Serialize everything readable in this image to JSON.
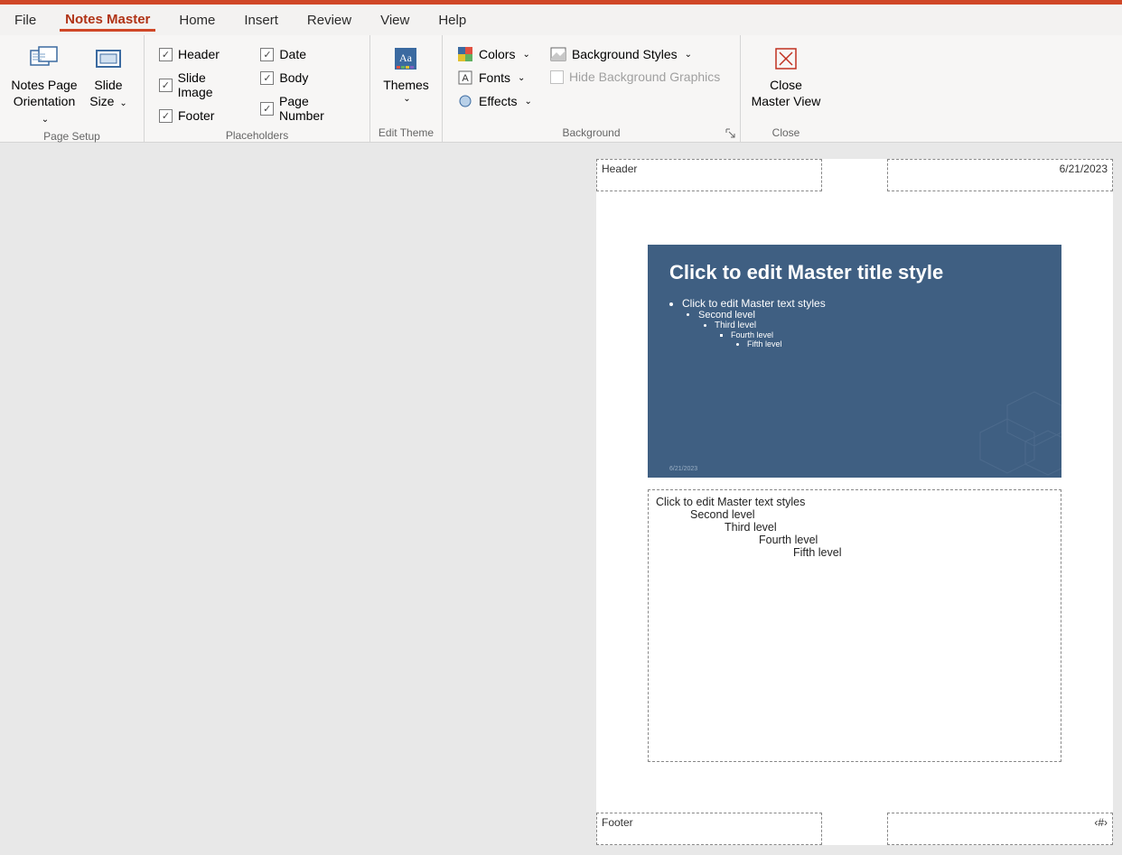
{
  "menu": {
    "items": [
      "File",
      "Notes Master",
      "Home",
      "Insert",
      "Review",
      "View",
      "Help"
    ],
    "active_index": 1
  },
  "ribbon": {
    "page_setup": {
      "label": "Page Setup",
      "notes_orientation": "Notes Page\nOrientation",
      "slide_size": "Slide\nSize"
    },
    "placeholders": {
      "label": "Placeholders",
      "items": [
        {
          "label": "Header",
          "checked": true
        },
        {
          "label": "Slide Image",
          "checked": true
        },
        {
          "label": "Footer",
          "checked": true
        },
        {
          "label": "Date",
          "checked": true
        },
        {
          "label": "Body",
          "checked": true
        },
        {
          "label": "Page Number",
          "checked": true
        }
      ]
    },
    "edit_theme": {
      "label": "Edit Theme",
      "themes": "Themes"
    },
    "background": {
      "label": "Background",
      "colors": "Colors",
      "fonts": "Fonts",
      "effects": "Effects",
      "bg_styles": "Background Styles",
      "hide_bg": "Hide Background Graphics"
    },
    "close": {
      "label": "Close",
      "close_master": "Close\nMaster View"
    }
  },
  "page": {
    "header": "Header",
    "date": "6/21/2023",
    "footer": "Footer",
    "pagenum": "‹#›",
    "slide": {
      "title": "Click to edit Master title style",
      "levels": [
        "Click to edit Master text styles",
        "Second level",
        "Third level",
        "Fourth level",
        "Fifth level"
      ],
      "tiny_date": "6/21/2023"
    },
    "body": {
      "levels": [
        "Click to edit Master text styles",
        "Second level",
        "Third level",
        "Fourth level",
        "Fifth level"
      ]
    }
  }
}
